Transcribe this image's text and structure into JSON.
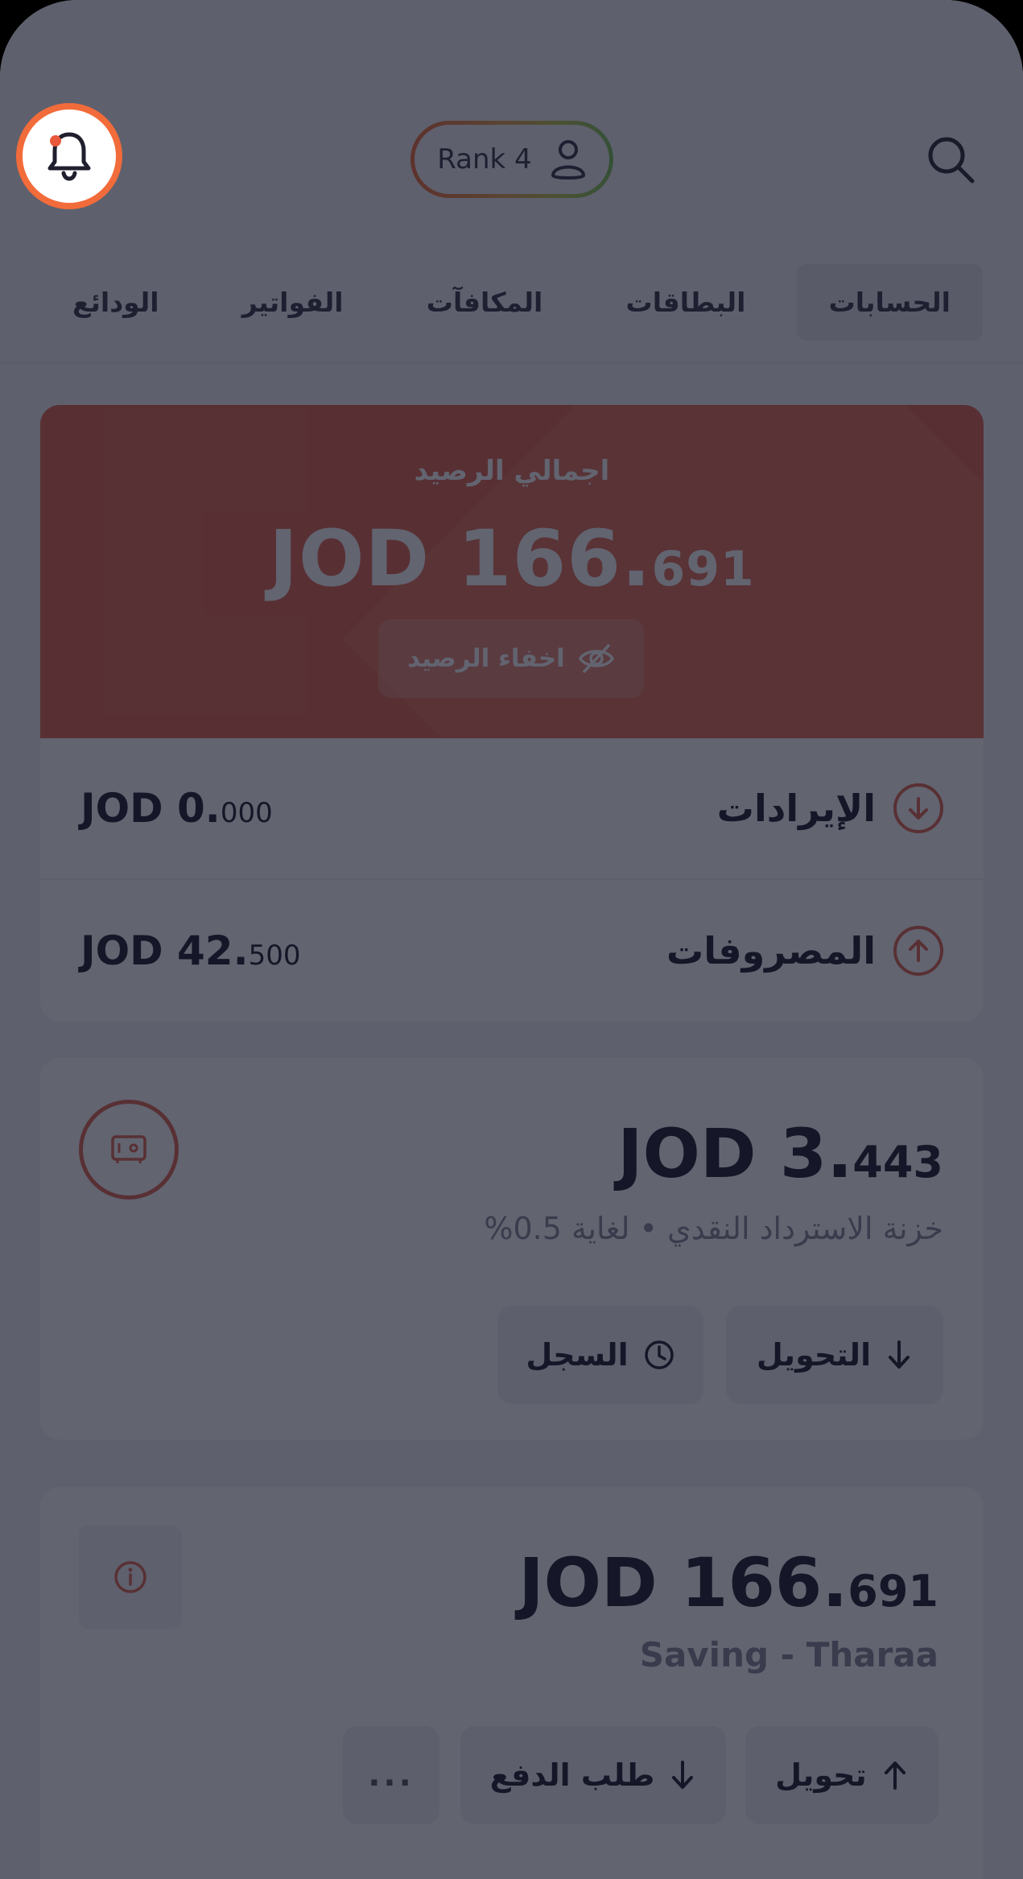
{
  "header": {
    "rank_label": "Rank 4",
    "search_icon": "search-icon",
    "bell_icon": "bell-icon",
    "profile_icon": "person-icon"
  },
  "tabs": [
    {
      "label": "الحسابات",
      "active": true
    },
    {
      "label": "البطاقات",
      "active": false
    },
    {
      "label": "المكافآت",
      "active": false
    },
    {
      "label": "الفواتير",
      "active": false
    },
    {
      "label": "الودائع",
      "active": false
    }
  ],
  "balance": {
    "label": "اجمالي الرصيد",
    "currency_int": "JOD 166.",
    "decimals": "691",
    "hide_label": "اخفاء الرصيد",
    "hide_icon": "eye-off-icon"
  },
  "flows": {
    "income": {
      "label": "الإيرادات",
      "value_int": "JOD 0.",
      "value_dec": "000",
      "icon": "arrow-down-circle-icon"
    },
    "expense": {
      "label": "المصروفات",
      "value_int": "JOD 42.",
      "value_dec": "500",
      "icon": "arrow-up-circle-icon"
    }
  },
  "vault": {
    "amount_int": "JOD 3.",
    "amount_dec": "443",
    "description": "خزنة الاسترداد النقدي • لغاية 0.5%",
    "transfer_label": "التحويل",
    "history_label": "السجل",
    "icon": "safe-icon"
  },
  "saving": {
    "amount_int": "JOD 166.",
    "amount_dec": "691",
    "name": "Saving - Tharaa",
    "transfer_label": "تحويل",
    "request_label": "طلب الدفع",
    "more_label": "...",
    "info_icon": "info-icon"
  },
  "colors": {
    "accent": "#E2684F",
    "highlight": "#F26B3A",
    "background": "#F2F2F7"
  }
}
